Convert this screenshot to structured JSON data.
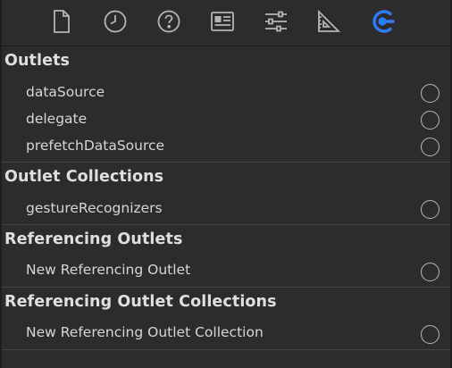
{
  "toolbar": {
    "icons": [
      "file-icon",
      "clock-icon",
      "help-icon",
      "identity-icon",
      "sliders-icon",
      "ruler-icon",
      "connections-icon"
    ],
    "active": "connections-icon",
    "accent": "#2f7df6",
    "icon_color": "#b5b5b5"
  },
  "sections": [
    {
      "title": "Outlets",
      "rows": [
        "dataSource",
        "delegate",
        "prefetchDataSource"
      ]
    },
    {
      "title": "Outlet Collections",
      "rows": [
        "gestureRecognizers"
      ]
    },
    {
      "title": "Referencing Outlets",
      "rows": [
        "New Referencing Outlet"
      ]
    },
    {
      "title": "Referencing Outlet Collections",
      "rows": [
        "New Referencing Outlet Collection"
      ]
    }
  ]
}
